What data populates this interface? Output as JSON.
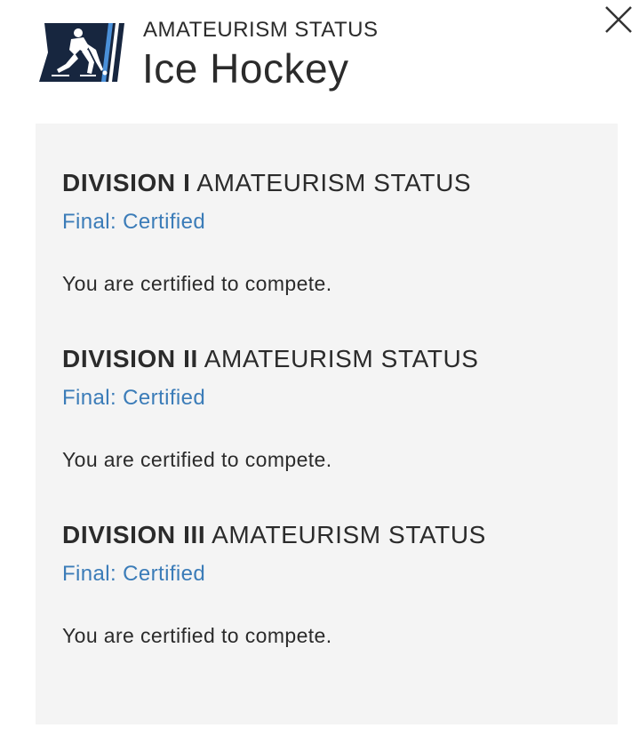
{
  "header": {
    "kicker": "AMATEURISM STATUS",
    "title": "Ice Hockey",
    "logo_icon": "ice-hockey-player-icon",
    "close_icon": "close-icon"
  },
  "colors": {
    "logo_navy": "#17263f",
    "logo_blue": "#4a90d9",
    "link_blue": "#3b7cb8",
    "panel_bg": "#f4f4f4"
  },
  "divisions": [
    {
      "name": "DIVISION I",
      "suffix": " AMATEURISM STATUS",
      "status": "Final: Certified",
      "message": "You are certified to compete."
    },
    {
      "name": "DIVISION II",
      "suffix": " AMATEURISM STATUS",
      "status": "Final: Certified",
      "message": "You are certified to compete."
    },
    {
      "name": "DIVISION III",
      "suffix": " AMATEURISM STATUS",
      "status": "Final: Certified",
      "message": "You are certified to compete."
    }
  ]
}
